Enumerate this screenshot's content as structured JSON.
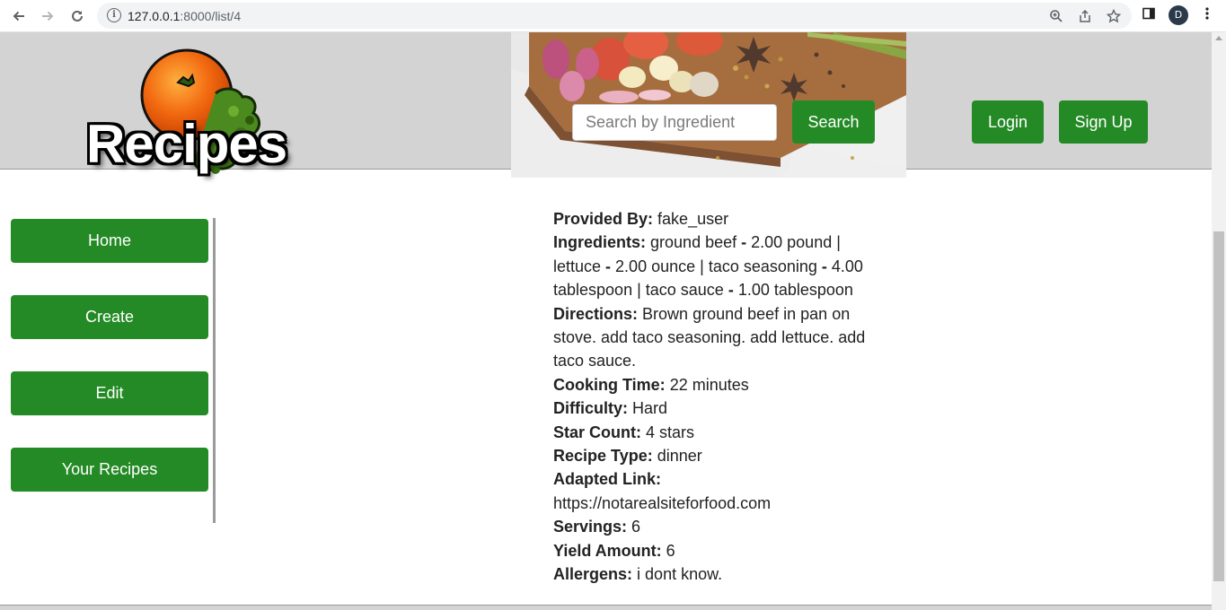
{
  "browser": {
    "url_host": "127.0.0.1",
    "url_path": ":8000/list/4",
    "profile_initial": "D"
  },
  "header": {
    "logo_text": "Recipes",
    "search_placeholder": "Search by Ingredient",
    "search_label": "Search",
    "login_label": "Login",
    "signup_label": "Sign Up"
  },
  "sidebar": {
    "items": [
      {
        "label": "Home"
      },
      {
        "label": "Create"
      },
      {
        "label": "Edit"
      },
      {
        "label": "Your Recipes"
      }
    ]
  },
  "recipe": {
    "provided_by_label": "Provided By:",
    "provided_by": "fake_user",
    "ingredients_label": "Ingredients:",
    "ingredients": [
      {
        "name": "ground beef",
        "sep": " - ",
        "qty": "2.00 pound"
      },
      {
        "name": "lettuce",
        "sep": " - ",
        "qty": "2.00 ounce"
      },
      {
        "name": "taco seasoning",
        "sep": " - ",
        "qty": "4.00 tablespoon"
      },
      {
        "name": "taco sauce",
        "sep": " - ",
        "qty": "1.00 tablespoon"
      }
    ],
    "ingredient_separator": " | ",
    "directions_label": "Directions:",
    "directions": "Brown ground beef in pan on stove. add taco seasoning. add lettuce. add taco sauce.",
    "cooking_time_label": "Cooking Time:",
    "cooking_time": "22 minutes",
    "difficulty_label": "Difficulty:",
    "difficulty": "Hard",
    "star_count_label": "Star Count:",
    "star_count": "4 stars",
    "recipe_type_label": "Recipe Type:",
    "recipe_type": "dinner",
    "adapted_link_label": "Adapted Link:",
    "adapted_link": "https://notarealsiteforfood.com",
    "servings_label": "Servings:",
    "servings": "6",
    "yield_label": "Yield Amount:",
    "yield_amount": "6",
    "allergens_label": "Allergens:",
    "allergens": "i dont know."
  },
  "colors": {
    "accent_green": "#248a25",
    "header_gray": "#d3d3d3"
  }
}
